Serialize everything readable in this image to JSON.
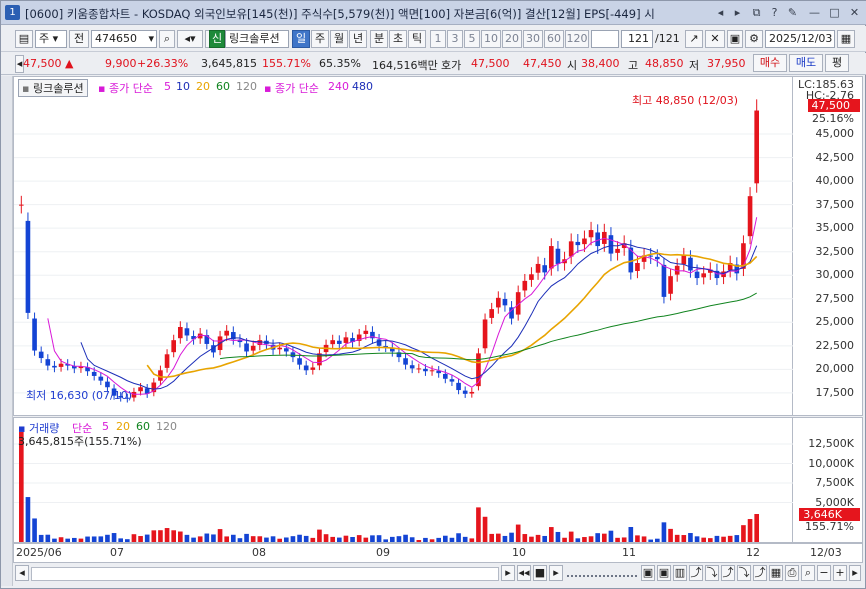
{
  "titlebar": {
    "num": "1",
    "text": "[0600] 키움종합차트 - KOSDAQ 외국인보유[145(천)] 주식수[5,579(천)] 액면[100] 자본금[6(억)] 결산[12월] EPS[-449] 시",
    "icons": [
      "chevron-left-icon",
      "chevron-right-icon",
      "restore-icon",
      "help-icon",
      "pin-icon",
      "minimize-icon",
      "maximize-icon",
      "close-icon"
    ]
  },
  "toolbar": {
    "market": "주",
    "mode": "전",
    "code": "474650",
    "badge": "신",
    "name": "링크솔루션",
    "periods": [
      "일",
      "주",
      "월",
      "년",
      "분",
      "초",
      "틱"
    ],
    "selected_period": "일",
    "intervals": [
      "1",
      "3",
      "5",
      "10",
      "20",
      "30",
      "60",
      "120"
    ],
    "count": "121",
    "total": "/121",
    "date": "2025/12/03"
  },
  "quote": {
    "price": "47,500",
    "change": "9,900",
    "rate": "+26.33%",
    "volume": "3,645,815",
    "vol_rate": "155.71%",
    "turnover": "65.35%",
    "amount": "164,516백만",
    "hoga_label": "호가",
    "ask": "47,500",
    "bid": "47,450",
    "open_label": "시",
    "open": "38,400",
    "high_label": "고",
    "high": "48,850",
    "low_label": "저",
    "low": "37,950",
    "sell_btn": "매수",
    "buy_btn": "매도",
    "avg_btn": "평"
  },
  "legend": {
    "name": "링크솔루션",
    "ma_label": "종가 단순",
    "ma_periods": [
      "5",
      "10",
      "20",
      "60",
      "120"
    ],
    "ma2_label": "종가 단순",
    "ma2_periods": [
      "240",
      "480"
    ],
    "vol_label": "거래량",
    "vol_ma_label": "단순",
    "vol_periods": [
      "5",
      "20",
      "60",
      "120"
    ],
    "vol_value": "3,645,815주(155.71%)"
  },
  "annotations": {
    "high": "최고 48,850 (12/03)",
    "low": "최저 16,630 (07/10)",
    "lc": "LC:185.63",
    "hc": "HC:-2.76",
    "last_price": "47,500",
    "last_rate": "25.16%",
    "last_vol": "3,646K",
    "last_vol_rate": "155.71%"
  },
  "yaxis": [
    "45,000",
    "42,500",
    "40,000",
    "37,500",
    "35,000",
    "32,500",
    "30,000",
    "27,500",
    "25,000",
    "22,500",
    "20,000",
    "17,500"
  ],
  "vaxis": [
    "12,500K",
    "10,000K",
    "7,500K",
    "5,000K"
  ],
  "dates": [
    "2025/06",
    "07",
    "08",
    "09",
    "10",
    "11",
    "12",
    "12/03"
  ],
  "colors": {
    "up": "#e5151d",
    "down": "#1444d4",
    "ma5": "#d81ad8",
    "ma10": "#1d2fb8",
    "ma20": "#e8a400",
    "ma60": "#11841f",
    "ma120": "#888888"
  },
  "chart_data": {
    "type": "candlestick",
    "ylim": [
      16000,
      50000
    ],
    "close": [
      37500,
      26000,
      22000,
      21200,
      20400,
      20200,
      20600,
      20400,
      20100,
      20300,
      19800,
      19300,
      18800,
      18100,
      17200,
      17000,
      16900,
      17600,
      18100,
      17400,
      18600,
      19900,
      21600,
      23100,
      24500,
      23600,
      23200,
      23800,
      22700,
      21800,
      23500,
      24100,
      23200,
      22900,
      21900,
      22500,
      23100,
      22700,
      22100,
      22300,
      21900,
      21300,
      20500,
      19900,
      20200,
      21700,
      22600,
      23100,
      22700,
      23400,
      22900,
      23700,
      24100,
      23300,
      22500,
      22400,
      21900,
      21300,
      20500,
      20100,
      20100,
      19800,
      19900,
      19600,
      19000,
      18700,
      17800,
      17400,
      17600,
      21700,
      25300,
      26400,
      27600,
      26800,
      25400,
      28200,
      29400,
      30100,
      31200,
      30300,
      33100,
      31200,
      31700,
      33600,
      33200,
      33900,
      34800,
      33100,
      34600,
      32300,
      32800,
      33400,
      30300,
      31300,
      32100,
      32000,
      31700,
      27700,
      29900,
      31000,
      32100,
      30500,
      29700,
      30200,
      30600,
      29700,
      30400,
      31300,
      30200,
      33400,
      38400,
      47500
    ],
    "ma20_last": 32700,
    "ma60_last": 26900
  }
}
